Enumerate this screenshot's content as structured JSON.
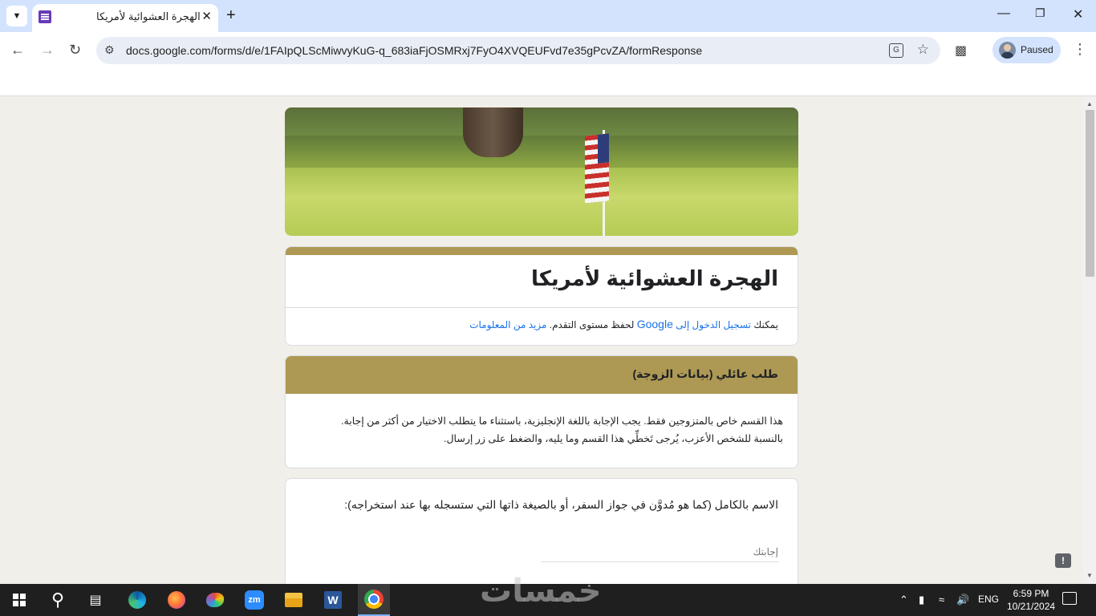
{
  "browser": {
    "tab_title": "الهجرة العشوائية لأمريكا",
    "url": "docs.google.com/forms/d/e/1FAIpQLScMiwvyKuG-q_683iaFjOSMRxj7FyO4XVQEUFvd7e35gPcvZA/formResponse",
    "profile_label": "Paused"
  },
  "form": {
    "title": "الهجرة العشوائية لأمريكا",
    "signin_prefix": "يمكنك",
    "signin_link": "تسجيل الدخول إلى",
    "signin_google": "Google",
    "signin_suffix": "لحفظ مستوى التقدم.",
    "more_info": "مزيد من المعلومات",
    "section_title": "طلب عائلي (بيانات الزوجة)",
    "section_description": "هذا القسم خاص بالمتزوجين فقط. يجب الإجابة باللغة الإنجليزية، باستثناء ما يتطلب الاختيار من أكثر من إجابة. بالنسبة للشخص الأعزب، يُرجى تَخطِّي هذا القسم وما يليه، والضغط على زر إرسال.",
    "question_text": "الاسم بالكامل (كما هو مُدوَّن في جواز السفر، أو بالصيغة ذاتها التي ستسجله بها عند استخراجه):",
    "answer_placeholder": "إجابتك"
  },
  "taskbar": {
    "language": "ENG",
    "time": "6:59 PM",
    "date": "10/21/2024"
  },
  "watermark": "خمسات",
  "colors": {
    "accent": "#ad9954",
    "page_bg": "#f1efe9",
    "link": "#1a73e8",
    "tabstrip": "#d3e3fd"
  }
}
